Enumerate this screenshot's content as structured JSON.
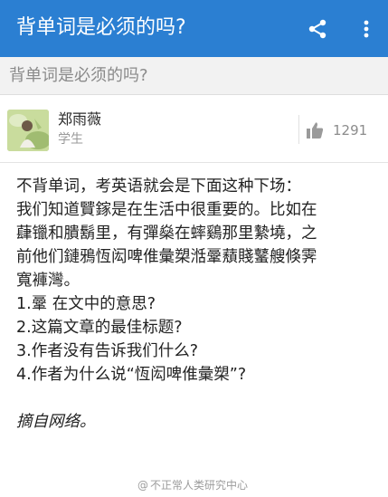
{
  "app_bar": {
    "title": "背单词是必须的吗?",
    "share_icon": "share-icon",
    "more_icon": "more-vertical-icon",
    "background": "#2b7fd2"
  },
  "question": {
    "title": "背单词是必须的吗?"
  },
  "author": {
    "name": "郑雨薇",
    "bio": "学生",
    "avatar_icon": "avatar",
    "vote_icon": "thumbs-up-icon",
    "votes": "1291"
  },
  "answer": {
    "lines": [
      "不背单词，考英语就会是下面这种下场：",
      "我们知道贒鎵是在生活中很重要的。比如在",
      "蕼镴和膭鬍里，有彈燊在蟀鷄那里縶墝，之",
      "前他们鏈鴉恆闳啤倠彙槊湉鞷蘈賤鼜艘倏霁",
      "寬褲灣。",
      "1.鞷 在文中的意思?",
      "2.这篇文章的最佳标题?",
      "3.作者没有告诉我们什么?",
      "4.作者为什么说“恆闳啤倠彙槊”?"
    ],
    "source": "摘自网络。"
  },
  "watermark": {
    "at": "@",
    "text": "不正常人类研究中心"
  }
}
